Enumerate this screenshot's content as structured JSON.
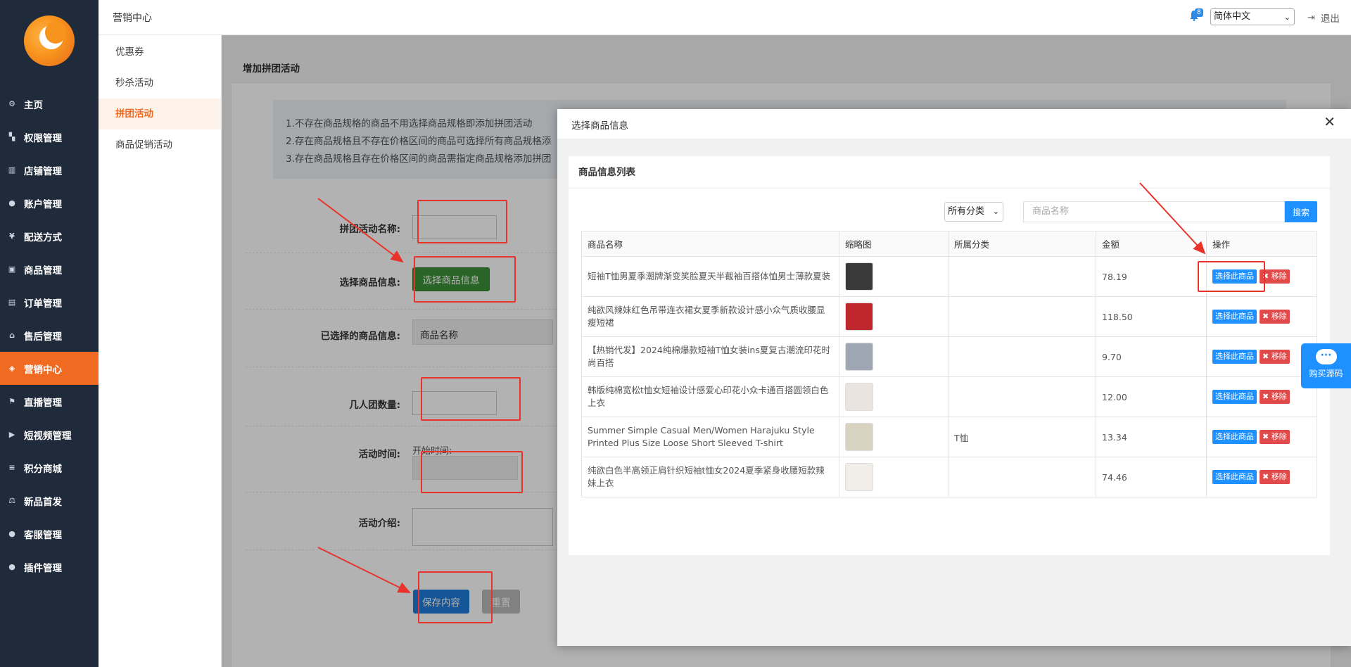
{
  "topbar": {
    "breadcrumb": "营销中心",
    "notification_count": "8",
    "language": "简体中文",
    "logout": "退出"
  },
  "nav": [
    {
      "label": "主页",
      "icon": "gear-icon"
    },
    {
      "label": "权限管理",
      "icon": "sitemap-icon"
    },
    {
      "label": "店铺管理",
      "icon": "map-icon"
    },
    {
      "label": "账户管理",
      "icon": "users-icon"
    },
    {
      "label": "配送方式",
      "icon": "yen-icon"
    },
    {
      "label": "商品管理",
      "icon": "image-icon"
    },
    {
      "label": "订单管理",
      "icon": "list-icon"
    },
    {
      "label": "售后管理",
      "icon": "bank-icon"
    },
    {
      "label": "营销中心",
      "icon": "tag-icon",
      "active": true
    },
    {
      "label": "直播管理",
      "icon": "flag-icon"
    },
    {
      "label": "短视频管理",
      "icon": "video-icon"
    },
    {
      "label": "积分商城",
      "icon": "sliders-icon"
    },
    {
      "label": "新品首发",
      "icon": "balance-icon"
    },
    {
      "label": "客服管理",
      "icon": "chat-icon"
    },
    {
      "label": "插件管理",
      "icon": "chat-icon"
    }
  ],
  "subnav": [
    {
      "label": "优惠券"
    },
    {
      "label": "秒杀活动"
    },
    {
      "label": "拼团活动",
      "active": true
    },
    {
      "label": "商品促销活动"
    }
  ],
  "form": {
    "title": "增加拼团活动",
    "tips": [
      "1.不存在商品规格的商品不用选择商品规格即添加拼团活动",
      "2.存在商品规格且不存在价格区间的商品可选择所有商品规格添",
      "3.存在商品规格且存在价格区间的商品需指定商品规格添加拼团"
    ],
    "name_label": "拼团活动名称:",
    "select_goods_label": "选择商品信息:",
    "select_goods_button": "选择商品信息",
    "selected_goods_label": "已选择的商品信息:",
    "selected_goods_header": "商品名称",
    "group_size_label": "几人团数量:",
    "time_label": "活动时间:",
    "start_time_label": "开始时间:",
    "intro_label": "活动介绍:",
    "save_button": "保存内容",
    "reset_button": "重置"
  },
  "modal": {
    "title": "选择商品信息",
    "list_title": "商品信息列表",
    "category_select": "所有分类",
    "search_placeholder": "商品名称",
    "search_button": "搜索",
    "columns": [
      "商品名称",
      "缩略图",
      "所属分类",
      "金额",
      "操作"
    ],
    "rows": [
      {
        "name": "短袖T恤男夏季潮牌渐变笑脸夏天半截袖百搭体恤男士薄款夏装",
        "category": "",
        "price": "78.19",
        "thumb_color": "#3a3a3a"
      },
      {
        "name": "纯欲风辣妹红色吊带连衣裙女夏季新款设计感小众气质收腰显瘦短裙",
        "category": "",
        "price": "118.50",
        "thumb_color": "#c0262d"
      },
      {
        "name": "【热销代发】2024纯棉爆款短袖T恤女装ins夏复古潮流印花时尚百搭",
        "category": "",
        "price": "9.70",
        "thumb_color": "#9ea7b3"
      },
      {
        "name": "韩版纯棉宽松t恤女短袖设计感爱心印花小众卡通百搭圆领白色上衣",
        "category": "",
        "price": "12.00",
        "thumb_color": "#e9e4df"
      },
      {
        "name": "Summer Simple Casual Men/Women Harajuku Style Printed Plus Size Loose Short Sleeved T-shirt",
        "category": "T恤",
        "price": "13.34",
        "thumb_color": "#d8d2c0"
      },
      {
        "name": "纯欲白色半高领正肩针织短袖t恤女2024夏季紧身收腰短款辣妹上衣",
        "category": "",
        "price": "74.46",
        "thumb_color": "#f1ede8"
      }
    ],
    "select_label": "选择此商品",
    "remove_label": "✖ 移除"
  },
  "float_widget": {
    "label": "购买源码"
  }
}
